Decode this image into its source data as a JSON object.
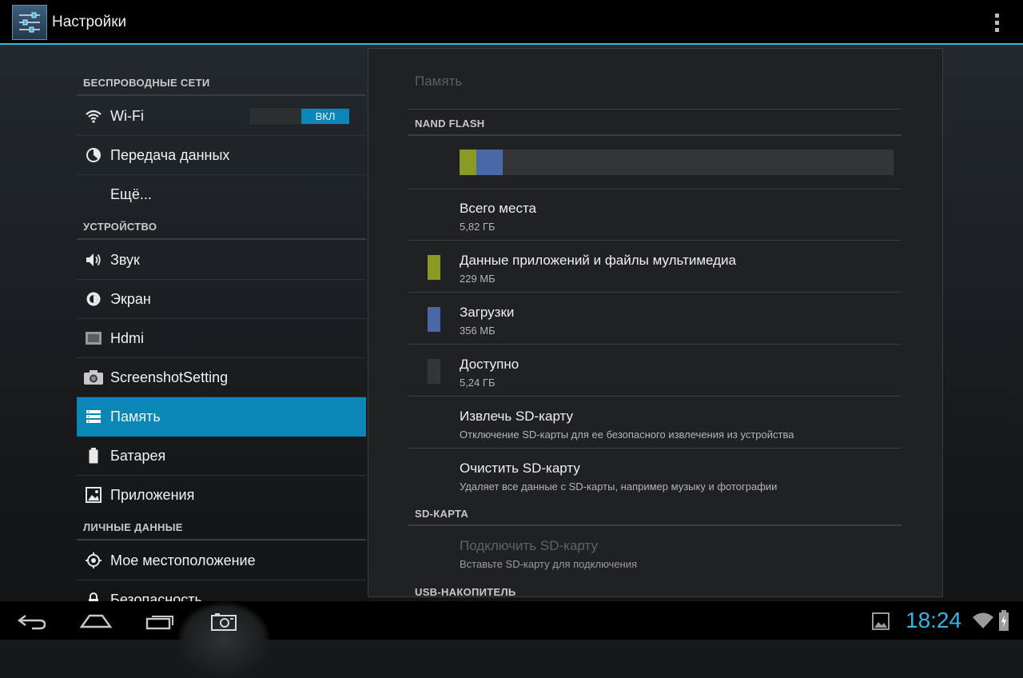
{
  "app": {
    "title": "Настройки",
    "icon": "settings-sliders-icon"
  },
  "sidebar": {
    "sections": [
      {
        "label": "БЕСПРОВОДНЫЕ СЕТИ"
      },
      {
        "label": "УСТРОЙСТВО"
      },
      {
        "label": "ЛИЧНЫЕ ДАННЫЕ"
      }
    ],
    "items": [
      {
        "label": "Wi-Fi",
        "icon": "wifi-icon",
        "toggle": "ВКЛ"
      },
      {
        "label": "Передача данных",
        "icon": "data-usage-icon"
      },
      {
        "label": "Ещё..."
      },
      {
        "label": "Звук",
        "icon": "speaker-icon"
      },
      {
        "label": "Экран",
        "icon": "brightness-icon"
      },
      {
        "label": "Hdmi",
        "icon": "hdmi-icon"
      },
      {
        "label": "ScreenshotSetting",
        "icon": "camera-icon"
      },
      {
        "label": "Память",
        "icon": "storage-icon",
        "selected": true
      },
      {
        "label": "Батарея",
        "icon": "battery-icon"
      },
      {
        "label": "Приложения",
        "icon": "apps-icon"
      },
      {
        "label": "Мое местоположение",
        "icon": "location-icon"
      },
      {
        "label": "Безопасность",
        "icon": "lock-icon"
      }
    ]
  },
  "storage": {
    "title": "Память",
    "nand_header": "NAND FLASH",
    "usage_bar": {
      "apps_fraction": 0.039,
      "downloads_fraction": 0.06
    },
    "rows": [
      {
        "title": "Всего места",
        "subtitle": "5,82 ГБ"
      },
      {
        "title": "Данные приложений и файлы мультимедиа",
        "subtitle": "229 МБ",
        "color": "#8a9a22"
      },
      {
        "title": "Загрузки",
        "subtitle": "356 МБ",
        "color": "#4a67a8"
      },
      {
        "title": "Доступно",
        "subtitle": "5,24 ГБ",
        "color": "#333538"
      },
      {
        "title": "Извлечь SD-карту",
        "subtitle": "Отключение SD-карты для ее безопасного извлечения из устройства"
      },
      {
        "title": "Очистить SD-карту",
        "subtitle": "Удаляет все данные с SD-карты, например музыку и фотографии"
      }
    ],
    "sd_header": "SD-КАРТА",
    "sd_row": {
      "title": "Подключить SD-карту",
      "subtitle": "Вставьте SD-карту для подключения",
      "disabled": true
    },
    "usb_header": "USB-НАКОПИТЕЛЬ"
  },
  "navbar": {
    "buttons": [
      "back-icon",
      "home-icon",
      "recent-apps-icon",
      "screenshot-icon"
    ]
  },
  "status": {
    "time": "18:24",
    "icons": [
      "gallery-notification-icon",
      "wifi-signal-icon",
      "battery-charging-icon"
    ]
  },
  "colors": {
    "accent": "#33b5e5",
    "selected": "#0a86b7",
    "apps": "#8a9a22",
    "downloads": "#4a67a8"
  }
}
